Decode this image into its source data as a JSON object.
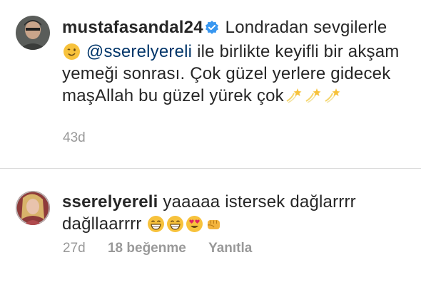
{
  "post": {
    "username": "mustafasandal24",
    "verified": true,
    "text_parts": {
      "intro": "Londradan sevgilerle",
      "mention": "@sserelyereli",
      "body": "ile birlikte keyifli bir akşam yemeği sonrası. Çok güzel yerlere gidecek maşAllah bu güzel yürek çok"
    },
    "emojis": [
      "winking-face",
      "dizzy",
      "dizzy",
      "dizzy"
    ],
    "timestamp": "43d"
  },
  "reply": {
    "username": "sserelyereli",
    "text": "yaaaaa istersek dağlarrrr dağllaarrrr",
    "emojis": [
      "grinning-face",
      "grinning-face",
      "heart-eyes-face",
      "fist"
    ],
    "timestamp": "27d",
    "likes_label": "18 beğenme",
    "reply_label": "Yanıtla"
  },
  "colors": {
    "text": "#262626",
    "mention": "#003569",
    "meta": "#999999",
    "verified": "#3897f0"
  }
}
